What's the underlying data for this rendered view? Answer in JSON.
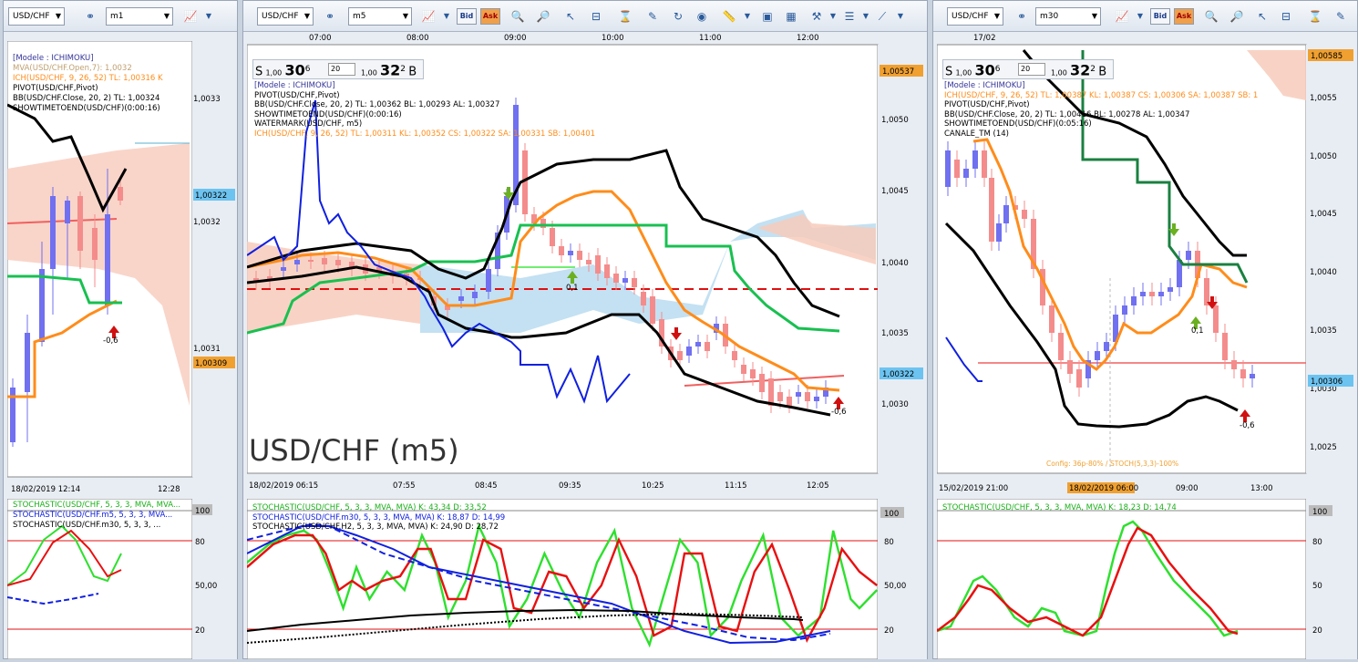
{
  "panels": [
    {
      "symbol": "USD/CHF",
      "timeframe": "m1",
      "legend": [
        "[Modele : ICHIMOKU]",
        "MVA(USD/CHF.Open,7): 1,0032",
        "ICH(USD/CHF, 9, 26, 52)  TL: 1,00316  K",
        "PIVOT(USD/CHF,Pivot)",
        "BB(USD/CHF.Close, 20, 2)  TL: 1,00324",
        "SHOWTIMETOEND(USD/CHF)(0:00:16)"
      ],
      "price_labels": [
        "1,0033",
        "1,0032",
        "1,0031"
      ],
      "tag_blue": "1,00322",
      "tag_orange": "1,00309",
      "marker": "-0,6",
      "time_labels": [
        "18/02/2019 12:14",
        "12:28"
      ],
      "stoch_legend": [
        "STOCHASTIC(USD/CHF, 5, 3, 3, MVA, MVA...",
        "STOCHASTIC(USD/CHF.m5, 5, 3, 3, MVA...",
        "STOCHASTIC(USD/CHF.m30, 5, 3, 3, ..."
      ],
      "stoch_levels": [
        "100",
        "80",
        "50,00",
        "20"
      ]
    },
    {
      "symbol": "USD/CHF",
      "timeframe": "m5",
      "top_times": [
        "07:00",
        "08:00",
        "09:00",
        "10:00",
        "11:00",
        "12:00"
      ],
      "sell": {
        "label": "S",
        "lot": "1,00",
        "big": "30",
        "sup": "6",
        "qty": "20"
      },
      "buy": {
        "label": "B",
        "lot": "1,00",
        "big": "32",
        "sup": "2"
      },
      "legend": [
        "[Modele : ICHIMOKU]",
        "PIVOT(USD/CHF,Pivot)",
        "BB(USD/CHF.Close, 20, 2)  TL: 1,00362  BL: 1,00293  AL: 1,00327",
        "SHOWTIMETOEND(USD/CHF)(0:00:16)",
        "WATERMARK(USD/CHF, m5)",
        "ICH(USD/CHF, 9, 26, 52)  TL: 1,00311  KL: 1,00352  CS: 1,00322  SA: 1,00331  SB: 1,00401"
      ],
      "watermark": "USD/CHF (m5)",
      "price_labels": [
        "1,0050",
        "1,0045",
        "1,0040",
        "1,0035",
        "1,0030"
      ],
      "tag_top": "1,00537",
      "tag_blue": "1,00322",
      "marker_pivot": "0,1",
      "marker": "-0,6",
      "time_labels": [
        "18/02/2019 06:15",
        "07:55",
        "08:45",
        "09:35",
        "10:25",
        "11:15",
        "12:05"
      ],
      "stoch_legend": [
        "STOCHASTIC(USD/CHF, 5, 3, 3, MVA, MVA)  K: 43,34  D: 33,52",
        "STOCHASTIC(USD/CHF.m30, 5, 3, 3, MVA, MVA)  K: 18,87  D: 14,99",
        "STOCHASTIC(USD/CHF.H2, 5, 3, 3, MVA, MVA)  K: 24,90  D: 28,72"
      ],
      "stoch_levels": [
        "100",
        "80",
        "50,00",
        "20"
      ]
    },
    {
      "symbol": "USD/CHF",
      "timeframe": "m30",
      "top_times": [
        "17/02"
      ],
      "sell": {
        "label": "S",
        "lot": "1,00",
        "big": "30",
        "sup": "6",
        "qty": "20"
      },
      "buy": {
        "label": "B",
        "lot": "1,00",
        "big": "32",
        "sup": "2"
      },
      "legend": [
        "[Modele : ICHIMOKU]",
        "ICH(USD/CHF, 9, 26, 52)  TL: 1,00387  KL: 1,00387  CS: 1,00306  SA: 1,00387  SB: 1",
        "PIVOT(USD/CHF,Pivot)",
        "BB(USD/CHF.Close, 20, 2)  TL: 1,00416  BL: 1,00278  AL: 1,00347",
        "SHOWTIMETOEND(USD/CHF)(0:05:16)",
        "CANALE_TM (14)"
      ],
      "price_labels": [
        "1,0055",
        "1,0050",
        "1,0045",
        "1,0040",
        "1,0035",
        "1,0030",
        "1,0025"
      ],
      "tag_top": "1,00585",
      "tag_blue": "1,00306",
      "marker_pivot": "0,1",
      "marker": "-0,6",
      "config": "Config: 36p-80% / STOCH(5,3,3)-100%",
      "time_labels": [
        "15/02/2019 21:00",
        "18/02/2019 06:00",
        "09:00",
        "13:00"
      ],
      "stoch_legend": [
        "STOCHASTIC(USD/CHF, 5, 3, 3, MVA, MVA)  K: 18,23  D: 14,74"
      ],
      "stoch_levels": [
        "100",
        "80",
        "50",
        "20"
      ]
    }
  ],
  "toolbar": {
    "bid": "Bid",
    "ask": "Ask"
  },
  "colors": {
    "bull": "#7070f0",
    "bear": "#f48c8c",
    "bb": "#000000",
    "tenkan": "#ff8c1a",
    "kijun": "#18c050",
    "chikou": "#1020e0",
    "kumo_up": "#f7cbbb",
    "kumo_down": "#b9dcf0",
    "pivot": "#e01010",
    "stoch_k": "#2ee02e",
    "stoch_d": "#e81010"
  }
}
